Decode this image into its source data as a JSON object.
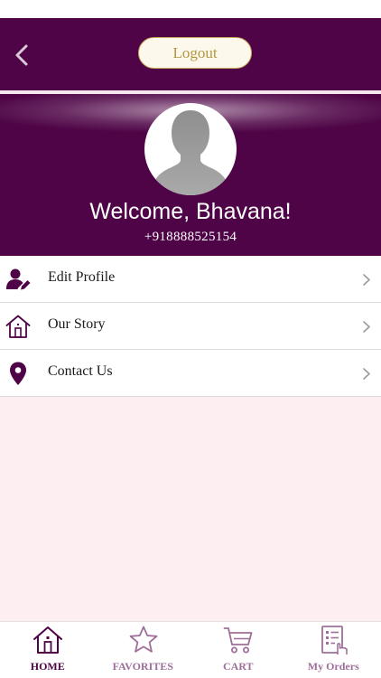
{
  "header": {
    "logout_label": "Logout"
  },
  "profile": {
    "welcome": "Welcome, Bhavana!",
    "phone": "+918888525154"
  },
  "menu": {
    "items": [
      {
        "label": "Edit Profile",
        "icon": "edit-profile-icon"
      },
      {
        "label": "Our Story",
        "icon": "home-icon"
      },
      {
        "label": "Contact Us",
        "icon": "location-pin-icon"
      }
    ]
  },
  "tabbar": {
    "tabs": [
      {
        "label": "HOME",
        "icon": "home-icon",
        "active": true
      },
      {
        "label": "FAVORITES",
        "icon": "star-icon",
        "active": false
      },
      {
        "label": "CART",
        "icon": "cart-icon",
        "active": false
      },
      {
        "label": "My Orders",
        "icon": "orders-icon",
        "active": false
      }
    ]
  },
  "colors": {
    "brand_purple": "#4e0446",
    "gold": "#b4963e",
    "background_pink": "#fdeef1",
    "inactive_tab": "#9e6f98"
  }
}
